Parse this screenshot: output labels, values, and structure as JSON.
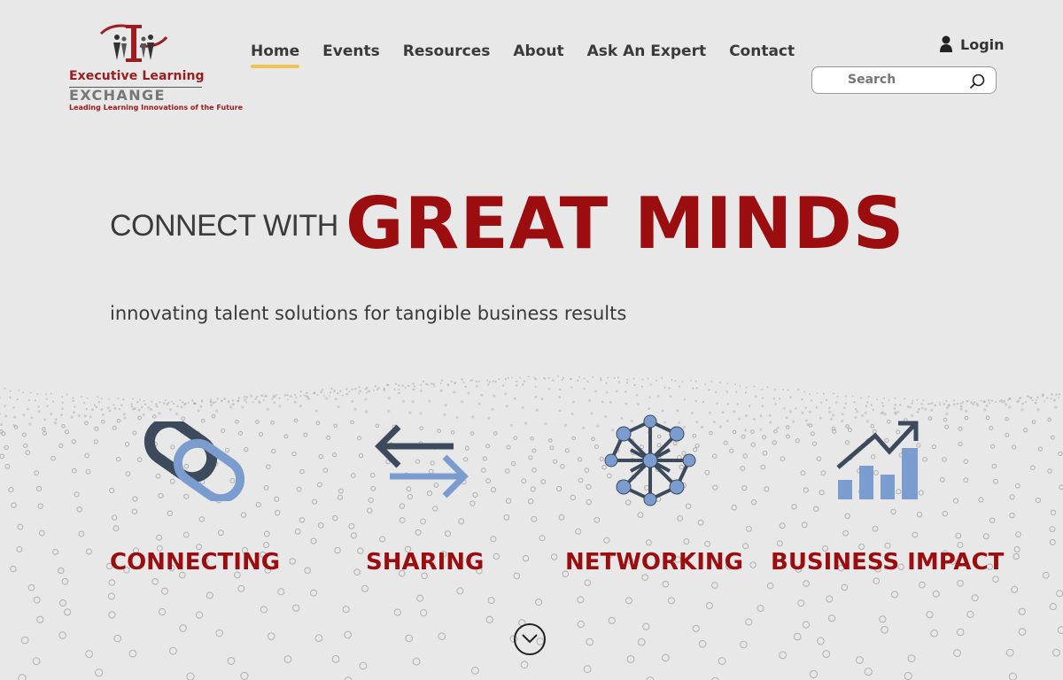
{
  "logo": {
    "line1": "Executive Learning",
    "line2": "EXCHANGE",
    "line3": "Leading Learning Innovations of the Future"
  },
  "nav": {
    "items": [
      "Home",
      "Events",
      "Resources",
      "About",
      "Ask An Expert",
      "Contact"
    ],
    "active": "Home"
  },
  "login": {
    "label": "Login",
    "icon": "user-icon"
  },
  "search": {
    "placeholder": "Search",
    "icon": "search-icon"
  },
  "hero": {
    "lead": "CONNECT WITH",
    "headline": "GREAT MINDS",
    "subtitle": "innovating talent solutions for tangible business results"
  },
  "features": [
    {
      "label": "CONNECTING",
      "icon": "link-icon"
    },
    {
      "label": "SHARING",
      "icon": "exchange-arrows-icon"
    },
    {
      "label": "NETWORKING",
      "icon": "network-icon"
    },
    {
      "label": "BUSINESS IMPACT",
      "icon": "growth-chart-icon"
    }
  ],
  "scroll": {
    "icon": "chevron-down-icon"
  },
  "colors": {
    "brand_red": "#9b0d0f",
    "accent_yellow": "#f2c14e",
    "icon_dark": "#3d4a5c",
    "icon_blue": "#7b9ccf",
    "background": "#e8e8e8"
  }
}
